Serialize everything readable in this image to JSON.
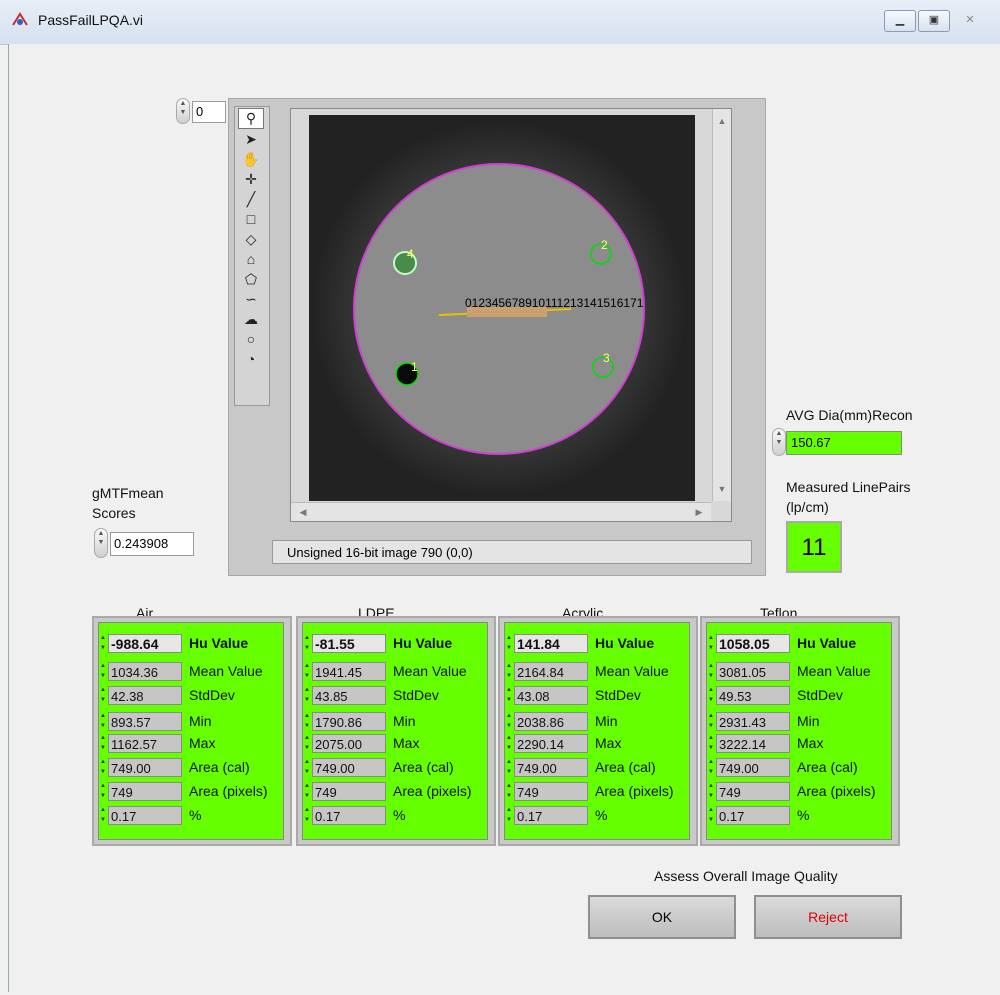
{
  "window": {
    "title": "PassFailLPQA.vi",
    "controls": [
      "▁",
      "▣",
      "✕"
    ]
  },
  "frame_index": {
    "value": "0"
  },
  "tools": [
    {
      "icon": "zoom-icon",
      "glyph": "⚲"
    },
    {
      "icon": "pointer-icon",
      "glyph": "➤"
    },
    {
      "icon": "pan-hand-icon",
      "glyph": "✋"
    },
    {
      "icon": "crosshair-icon",
      "glyph": "✛"
    },
    {
      "icon": "line-icon",
      "glyph": "╱"
    },
    {
      "icon": "rectangle-icon",
      "glyph": "□"
    },
    {
      "icon": "rotated-rectangle-icon",
      "glyph": "◇"
    },
    {
      "icon": "annulus-icon",
      "glyph": "⌂"
    },
    {
      "icon": "polygon-icon",
      "glyph": "⬠"
    },
    {
      "icon": "freehand-icon",
      "glyph": "∽"
    },
    {
      "icon": "freehand-region-icon",
      "glyph": "☁"
    },
    {
      "icon": "oval-icon",
      "glyph": "○"
    },
    {
      "icon": "pie-icon",
      "glyph": "◔"
    }
  ],
  "image": {
    "status": "Unsigned 16-bit image 790    (0,0)",
    "roi_labels": [
      "1",
      "2",
      "3",
      "4"
    ],
    "line_pair_label": "012345678910111213141516171"
  },
  "gmtf": {
    "label": "gMTFmean Scores",
    "value": "0.243908"
  },
  "avg_dia": {
    "label": "AVG Dia(mm)Recon",
    "value": "150.67"
  },
  "line_pairs": {
    "label": "Measured LinePairs (lp/cm)",
    "value": "11"
  },
  "row_labels": [
    "Hu Value",
    "Mean Value",
    "StdDev",
    "Min",
    "Max",
    "Area (cal)",
    "Area (pixels)",
    "%"
  ],
  "tables": [
    {
      "title": "Air",
      "values": [
        "-988.64",
        "1034.36",
        "42.38",
        "893.57",
        "1162.57",
        "749.00",
        "749",
        "0.17"
      ]
    },
    {
      "title": "LDPE",
      "values": [
        "-81.55",
        "1941.45",
        "43.85",
        "1790.86",
        "2075.00",
        "749.00",
        "749",
        "0.17"
      ]
    },
    {
      "title": "Acrylic",
      "values": [
        "141.84",
        "2164.84",
        "43.08",
        "2038.86",
        "2290.14",
        "749.00",
        "749",
        "0.17"
      ]
    },
    {
      "title": "Teflon",
      "values": [
        "1058.05",
        "3081.05",
        "49.53",
        "2931.43",
        "3222.14",
        "749.00",
        "749",
        "0.17"
      ]
    }
  ],
  "assess": {
    "label": "Assess Overall Image Quality",
    "ok": "OK",
    "reject": "Reject",
    "reject_color": "#e00000"
  },
  "colors": {
    "indicator_green": "#66ff00",
    "roi_green": "#00dd00",
    "phantom_outline": "#d040d0"
  }
}
